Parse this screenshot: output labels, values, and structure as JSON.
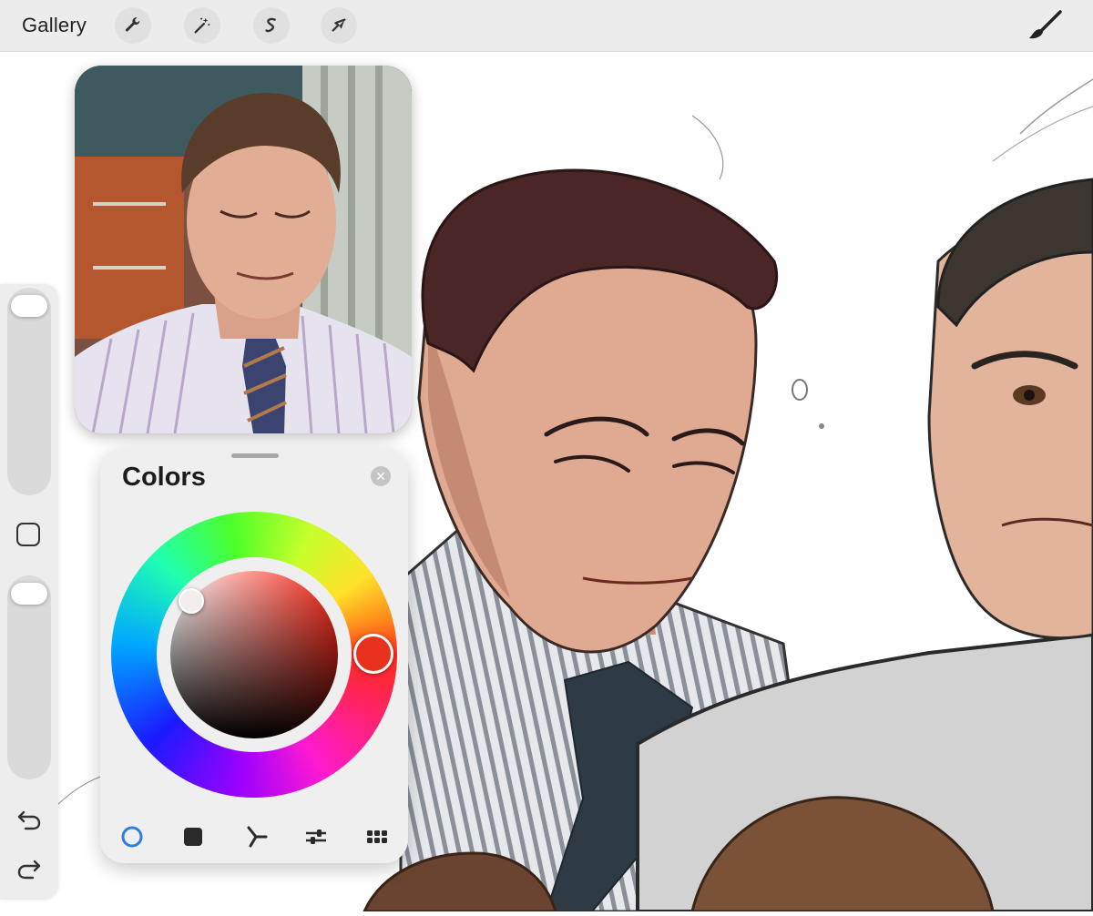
{
  "topbar": {
    "gallery_label": "Gallery",
    "tools": [
      {
        "name": "actions",
        "icon": "wrench-icon"
      },
      {
        "name": "adjustments",
        "icon": "magic-wand-icon"
      },
      {
        "name": "selection",
        "icon": "selection-s-icon"
      },
      {
        "name": "transform",
        "icon": "arrow-cursor-icon"
      }
    ],
    "brush_icon": "paintbrush-icon"
  },
  "colors_panel": {
    "title": "Colors",
    "current_color": "#e8321e",
    "tabs": [
      {
        "name": "disc",
        "icon": "color-disc-icon",
        "active": true
      },
      {
        "name": "classic",
        "icon": "square-swatch-icon",
        "active": false
      },
      {
        "name": "harmony",
        "icon": "harmony-icon",
        "active": false
      },
      {
        "name": "value",
        "icon": "sliders-icon",
        "active": false
      },
      {
        "name": "palettes",
        "icon": "palette-grid-icon",
        "active": false
      }
    ]
  },
  "sidebar": {
    "brush_size_level": 0.95,
    "opacity_level": 0.95,
    "undo_icon": "undo-icon",
    "redo_icon": "redo-icon"
  },
  "colors": {
    "accent": "#2f7de1",
    "toolbar_bg": "#ececec"
  }
}
